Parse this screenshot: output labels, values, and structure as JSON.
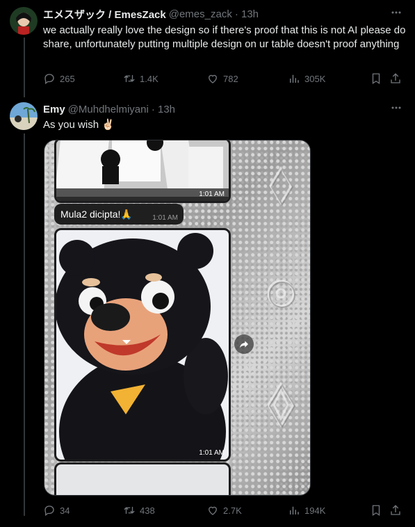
{
  "tweet1": {
    "display_name": "エメスザック / EmesZack",
    "handle": "@emes_zack",
    "time": "· 13h",
    "text": "we actually really love the design so if there's proof that this is not AI please do share, unfortunately putting multiple design on ur table doesn't proof anything",
    "replies": "265",
    "retweets": "1.4K",
    "likes": "782",
    "views": "305K"
  },
  "tweet2": {
    "display_name": "Emy",
    "handle": "@Muhdhelmiyani",
    "time": "· 13h",
    "text": "As you wish ✌🏻",
    "replies": "34",
    "retweets": "438",
    "likes": "2.7K",
    "views": "194K",
    "media": {
      "ts1": "1:01 AM",
      "message_text": "Mula2 dicipta!🙏",
      "message_time": "1:01 AM",
      "ts2": "1:01 AM"
    }
  },
  "icons": [
    "reply-icon",
    "retweet-icon",
    "like-icon",
    "views-icon",
    "bookmark-icon",
    "share-icon",
    "more-icon",
    "forward-icon"
  ]
}
